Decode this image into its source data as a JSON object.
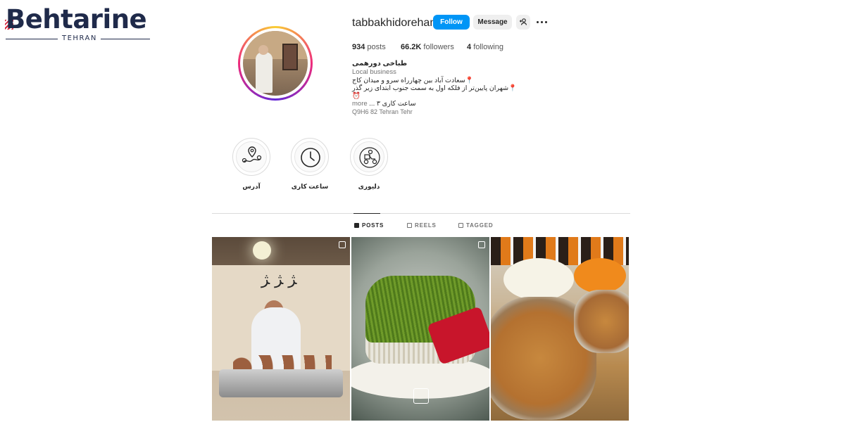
{
  "watermark": {
    "brand": "Behtarine",
    "city": "TEHRAN"
  },
  "profile": {
    "username": "tabbakhidorehami",
    "buttons": {
      "follow": "Follow",
      "message": "Message"
    },
    "stats": {
      "posts_count": "934",
      "posts_label": "posts",
      "followers_count": "66.2K",
      "followers_label": "followers",
      "following_count": "4",
      "following_label": "following"
    },
    "bio": {
      "name": "طباخی دورهمی",
      "category": "Local business",
      "line1": "📍سعادت آباد بین چهارراه سرو و میدان کاج",
      "line2": "📍شهران پایین‌تر از فلکه اول به سمت جنوب ابتدای زیر گذر",
      "line3": "⏰",
      "line4": "ساعت کاری ۳ ...",
      "more": "more",
      "address": "Q9H6 82 Tehran Tehr"
    }
  },
  "highlights": [
    {
      "label": "آدرس",
      "icon": "map-pin-icon"
    },
    {
      "label": "ساعت کاری",
      "icon": "clock-icon"
    },
    {
      "label": "دلیوری",
      "icon": "delivery-scooter-icon"
    }
  ],
  "tabs": [
    {
      "label": "POSTS",
      "icon": "grid-icon",
      "active": true
    },
    {
      "label": "REELS",
      "icon": "reels-icon",
      "active": false
    },
    {
      "label": "TAGGED",
      "icon": "tagged-icon",
      "active": false
    }
  ],
  "colors": {
    "follow_button": "#0095f6",
    "secondary_button": "#efefef",
    "text": "#262626",
    "muted": "#737373"
  }
}
